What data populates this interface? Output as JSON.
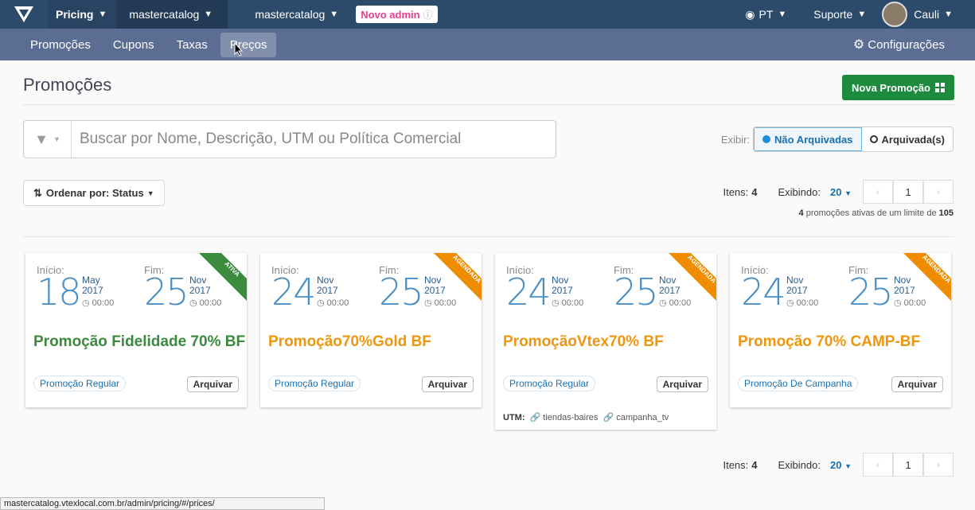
{
  "topbar": {
    "app": "Pricing",
    "account1": "mastercatalog",
    "account2": "mastercatalog",
    "new_admin": "Novo admin",
    "language": "PT",
    "support": "Suporte",
    "user": "Cauli"
  },
  "subnav": {
    "tabs": [
      "Promoções",
      "Cupons",
      "Taxas",
      "Preços"
    ],
    "settings": "Configurações"
  },
  "page": {
    "title": "Promoções",
    "new_button": "Nova Promoção"
  },
  "search": {
    "placeholder": "Buscar por Nome, Descrição, UTM ou Política Comercial"
  },
  "display": {
    "label": "Exibir:",
    "active": "Não Arquivadas",
    "archived": "Arquivada(s)"
  },
  "sort": {
    "label": "Ordenar por: Status"
  },
  "pager": {
    "items_label": "Itens:",
    "items_count": "4",
    "showing_label": "Exibindo:",
    "per_page": "20",
    "current_page": "1"
  },
  "limit": {
    "active": "4",
    "text": " promoções ativas de um limite de ",
    "max": "105"
  },
  "cards": [
    {
      "start_label": "Início:",
      "start_day": "18",
      "start_month": "May",
      "start_year": "2017",
      "start_time": "00:00",
      "end_label": "Fim:",
      "end_day": "25",
      "end_month": "Nov",
      "end_year": "2017",
      "end_time": "00:00",
      "status": "ATIVA",
      "status_color": "#3b8a3e",
      "name": "Promoção Fidelidade 70% BF",
      "name_color": "#3b8a3e",
      "type": "Promoção Regular",
      "archive": "Arquivar"
    },
    {
      "start_label": "Início:",
      "start_day": "24",
      "start_month": "Nov",
      "start_year": "2017",
      "start_time": "00:00",
      "end_label": "Fim:",
      "end_day": "25",
      "end_month": "Nov",
      "end_year": "2017",
      "end_time": "00:00",
      "status": "AGENDADA",
      "status_color": "#f08c00",
      "name": "Promoção70%Gold BF",
      "name_color": "#f0960e",
      "type": "Promoção Regular",
      "archive": "Arquivar"
    },
    {
      "start_label": "Início:",
      "start_day": "24",
      "start_month": "Nov",
      "start_year": "2017",
      "start_time": "00:00",
      "end_label": "Fim:",
      "end_day": "25",
      "end_month": "Nov",
      "end_year": "2017",
      "end_time": "00:00",
      "status": "AGENDADA",
      "status_color": "#f08c00",
      "name": "PromoçãoVtex70% BF",
      "name_color": "#f0960e",
      "type": "Promoção Regular",
      "archive": "Arquivar",
      "utm_label": "UTM:",
      "utm_source": "tiendas-baires",
      "utm_campaign": "campanha_tv"
    },
    {
      "start_label": "Início:",
      "start_day": "24",
      "start_month": "Nov",
      "start_year": "2017",
      "start_time": "00:00",
      "end_label": "Fim:",
      "end_day": "25",
      "end_month": "Nov",
      "end_year": "2017",
      "end_time": "00:00",
      "status": "AGENDADA",
      "status_color": "#f08c00",
      "name": "Promoção 70% CAMP-BF",
      "name_color": "#f0960e",
      "type": "Promoção De Campanha",
      "archive": "Arquivar"
    }
  ],
  "statusbar": "mastercatalog.vtexlocal.com.br/admin/pricing/#/prices/"
}
